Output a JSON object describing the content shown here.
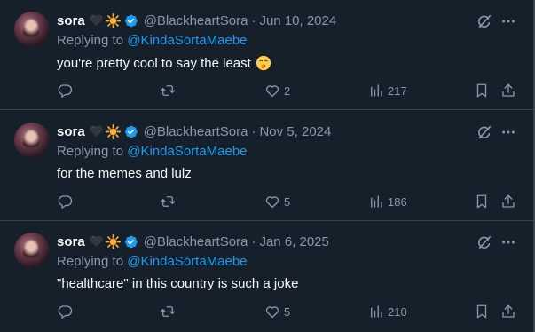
{
  "colors": {
    "background": "#15202b",
    "text": "#f7f9f9",
    "muted": "#8b98a5",
    "link": "#1d9bf0",
    "divider": "#38444d"
  },
  "tweets": [
    {
      "name": "sora",
      "handle": "@BlackheartSora",
      "separator": "·",
      "date": "Jun 10, 2024",
      "reply_prefix": "Replying to ",
      "reply_to": "@KindaSortaMaebe",
      "text": "you're pretty cool to say the least",
      "text_emoji": "shushing-face-emoji",
      "replies": "",
      "retweets": "",
      "likes": "2",
      "views": "217"
    },
    {
      "name": "sora",
      "handle": "@BlackheartSora",
      "separator": "·",
      "date": "Nov 5, 2024",
      "reply_prefix": "Replying to ",
      "reply_to": "@KindaSortaMaebe",
      "text": "for the memes and lulz",
      "text_emoji": "",
      "replies": "",
      "retweets": "",
      "likes": "5",
      "views": "186"
    },
    {
      "name": "sora",
      "handle": "@BlackheartSora",
      "separator": "·",
      "date": "Jan 6, 2025",
      "reply_prefix": "Replying to ",
      "reply_to": "@KindaSortaMaebe",
      "text": "\"healthcare\" in this country is such a joke",
      "text_emoji": "",
      "replies": "",
      "retweets": "",
      "likes": "5",
      "views": "210"
    }
  ],
  "icons": {
    "name_badges": [
      "black-heart-emoji",
      "sun-emoji",
      "verified-badge-icon"
    ],
    "top_right": [
      "grok-icon",
      "more-icon"
    ],
    "actions": [
      "reply-icon",
      "retweet-icon",
      "like-icon",
      "views-icon",
      "bookmark-icon",
      "share-icon"
    ]
  }
}
